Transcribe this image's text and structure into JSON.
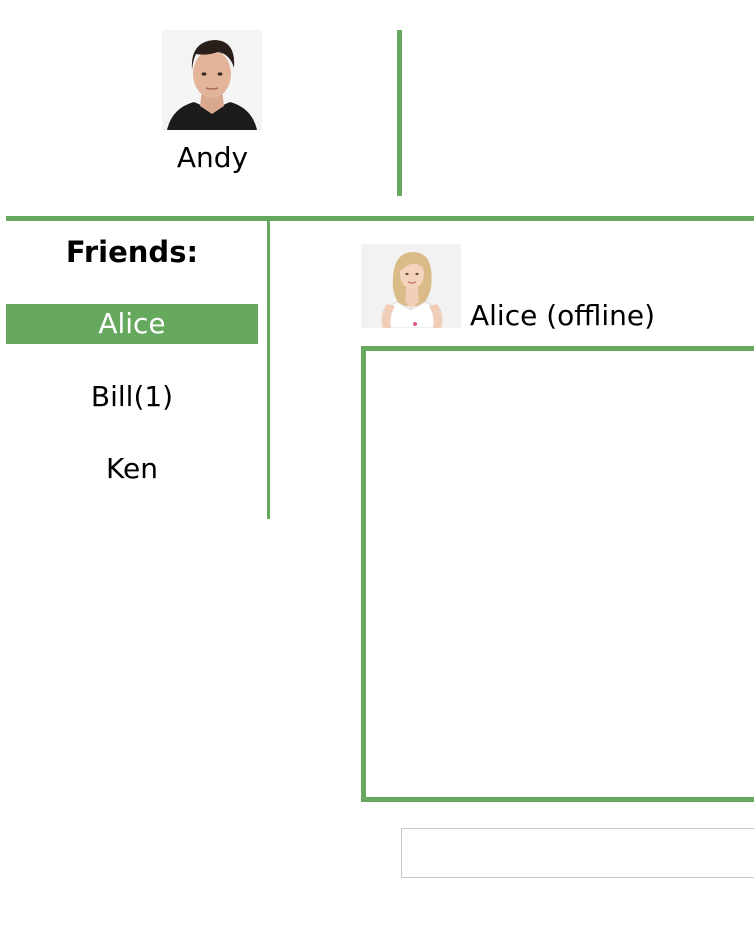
{
  "current_user": {
    "name": "Andy",
    "avatar_icon": "user-photo-andy"
  },
  "friends": {
    "title": "Friends:",
    "items": [
      {
        "label": "Alice",
        "active": true
      },
      {
        "label": "Bill(1)",
        "active": false
      },
      {
        "label": "Ken",
        "active": false
      }
    ]
  },
  "chat": {
    "contact_label": "Alice (offline)",
    "avatar_icon": "user-photo-alice",
    "input_value": ""
  },
  "colors": {
    "accent": "#66a85e",
    "active_text": "#ffffff",
    "input_border": "#c8c8c8"
  }
}
